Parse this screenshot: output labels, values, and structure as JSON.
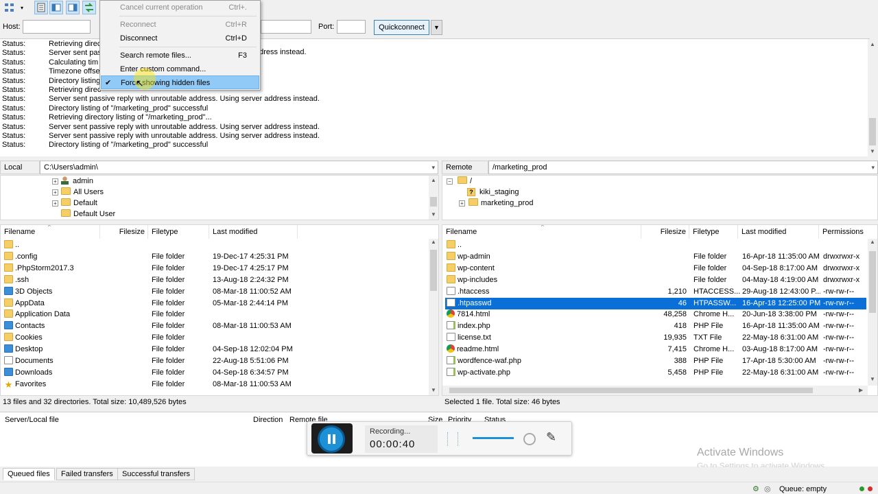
{
  "menu": {
    "items": [
      {
        "label": "Cancel current operation",
        "shortcut": "Ctrl+.",
        "disabled": true
      },
      {
        "label": "Reconnect",
        "shortcut": "Ctrl+R",
        "disabled": true
      },
      {
        "label": "Disconnect",
        "shortcut": "Ctrl+D",
        "disabled": false
      },
      {
        "label": "Search remote files...",
        "shortcut": "F3",
        "disabled": false
      },
      {
        "label": "Enter custom command...",
        "shortcut": "",
        "disabled": false
      },
      {
        "label": "Force showing hidden files",
        "shortcut": "",
        "checked": true,
        "highlighted": true
      }
    ]
  },
  "quickconnect": {
    "host_label": "Host:",
    "host_value": "",
    "port_label": "Port:",
    "port_value": "",
    "button_label": "Quickconnect"
  },
  "log": [
    {
      "key": "Status:",
      "msg": "Retrieving direc"
    },
    {
      "key": "Status:",
      "msg": "Server sent pass"
    },
    {
      "key": "Status:",
      "msg": "Calculating tim"
    },
    {
      "key": "Status:",
      "msg": "Timezone offse"
    },
    {
      "key": "Status:",
      "msg": "Directory listing"
    },
    {
      "key": "Status:",
      "msg": "Retrieving direc"
    },
    {
      "key": "Status:",
      "msg": "Server sent passive reply with unroutable address. Using server address instead."
    },
    {
      "key": "Status:",
      "msg": "Directory listing of \"/marketing_prod\" successful"
    },
    {
      "key": "Status:",
      "msg": "Retrieving directory listing of \"/marketing_prod\"..."
    },
    {
      "key": "Status:",
      "msg": "Server sent passive reply with unroutable address. Using server address instead."
    },
    {
      "key": "Status:",
      "msg": "Server sent passive reply with unroutable address. Using server address instead."
    },
    {
      "key": "Status:",
      "msg": "Directory listing of \"/marketing_prod\" successful"
    }
  ],
  "log_tail_fragment": "ddress instead.",
  "local": {
    "site_label": "Local site:",
    "path": "C:\\Users\\admin\\",
    "tree": [
      "admin",
      "All Users",
      "Default",
      "Default User"
    ],
    "headers": [
      "Filename",
      "Filesize",
      "Filetype",
      "Last modified"
    ],
    "files": [
      {
        "name": "..",
        "size": "",
        "type": "",
        "modified": "",
        "icon": "folder"
      },
      {
        "name": ".config",
        "size": "",
        "type": "File folder",
        "modified": "19-Dec-17 4:25:31 PM",
        "icon": "folder"
      },
      {
        "name": ".PhpStorm2017.3",
        "size": "",
        "type": "File folder",
        "modified": "19-Dec-17 4:25:17 PM",
        "icon": "folder"
      },
      {
        "name": ".ssh",
        "size": "",
        "type": "File folder",
        "modified": "13-Aug-18 2:24:32 PM",
        "icon": "folder"
      },
      {
        "name": "3D Objects",
        "size": "",
        "type": "File folder",
        "modified": "08-Mar-18 11:00:52 AM",
        "icon": "blue"
      },
      {
        "name": "AppData",
        "size": "",
        "type": "File folder",
        "modified": "05-Mar-18 2:44:14 PM",
        "icon": "folder"
      },
      {
        "name": "Application Data",
        "size": "",
        "type": "File folder",
        "modified": "",
        "icon": "folder"
      },
      {
        "name": "Contacts",
        "size": "",
        "type": "File folder",
        "modified": "08-Mar-18 11:00:53 AM",
        "icon": "blue"
      },
      {
        "name": "Cookies",
        "size": "",
        "type": "File folder",
        "modified": "",
        "icon": "folder"
      },
      {
        "name": "Desktop",
        "size": "",
        "type": "File folder",
        "modified": "04-Sep-18 12:02:04 PM",
        "icon": "blue"
      },
      {
        "name": "Documents",
        "size": "",
        "type": "File folder",
        "modified": "22-Aug-18 5:51:06 PM",
        "icon": "file"
      },
      {
        "name": "Downloads",
        "size": "",
        "type": "File folder",
        "modified": "04-Sep-18 6:34:57 PM",
        "icon": "blue"
      },
      {
        "name": "Favorites",
        "size": "",
        "type": "File folder",
        "modified": "08-Mar-18 11:00:53 AM",
        "icon": "star"
      }
    ],
    "status": "13 files and 32 directories. Total size: 10,489,526 bytes"
  },
  "remote": {
    "site_label": "Remote site:",
    "path": "/marketing_prod",
    "tree": [
      "/",
      "kiki_staging",
      "marketing_prod"
    ],
    "headers": [
      "Filename",
      "Filesize",
      "Filetype",
      "Last modified",
      "Permissions"
    ],
    "files": [
      {
        "name": "..",
        "size": "",
        "type": "",
        "modified": "",
        "perms": "",
        "icon": "folder"
      },
      {
        "name": "wp-admin",
        "size": "",
        "type": "File folder",
        "modified": "16-Apr-18 11:35:00 AM",
        "perms": "drwxrwxr-x",
        "icon": "folder"
      },
      {
        "name": "wp-content",
        "size": "",
        "type": "File folder",
        "modified": "04-Sep-18 8:17:00 AM",
        "perms": "drwxrwxr-x",
        "icon": "folder"
      },
      {
        "name": "wp-includes",
        "size": "",
        "type": "File folder",
        "modified": "04-May-18 4:19:00 AM",
        "perms": "drwxrwxr-x",
        "icon": "folder"
      },
      {
        "name": ".htaccess",
        "size": "1,210",
        "type": "HTACCESS...",
        "modified": "29-Aug-18 12:43:00 P...",
        "perms": "-rw-rw-r--",
        "icon": "file"
      },
      {
        "name": ".htpasswd",
        "size": "46",
        "type": "HTPASSW...",
        "modified": "16-Apr-18 12:25:00 PM",
        "perms": "-rw-rw-r--",
        "icon": "file",
        "selected": true
      },
      {
        "name": "7814.html",
        "size": "48,258",
        "type": "Chrome H...",
        "modified": "20-Jun-18 3:38:00 PM",
        "perms": "-rw-rw-r--",
        "icon": "chrome"
      },
      {
        "name": "index.php",
        "size": "418",
        "type": "PHP File",
        "modified": "16-Apr-18 11:35:00 AM",
        "perms": "-rw-rw-r--",
        "icon": "php"
      },
      {
        "name": "license.txt",
        "size": "19,935",
        "type": "TXT File",
        "modified": "22-May-18 6:31:00 AM",
        "perms": "-rw-rw-r--",
        "icon": "file"
      },
      {
        "name": "readme.html",
        "size": "7,415",
        "type": "Chrome H...",
        "modified": "03-Aug-18 8:17:00 AM",
        "perms": "-rw-rw-r--",
        "icon": "chrome"
      },
      {
        "name": "wordfence-waf.php",
        "size": "388",
        "type": "PHP File",
        "modified": "17-Apr-18 5:30:00 AM",
        "perms": "-rw-rw-r--",
        "icon": "php"
      },
      {
        "name": "wp-activate.php",
        "size": "5,458",
        "type": "PHP File",
        "modified": "22-May-18 6:31:00 AM",
        "perms": "-rw-rw-r--",
        "icon": "php"
      }
    ],
    "status": "Selected 1 file. Total size: 46 bytes"
  },
  "queue": {
    "headers": [
      "Server/Local file",
      "Direction",
      "Remote file",
      "Size",
      "Priority",
      "Status"
    ],
    "tabs": [
      "Queued files",
      "Failed transfers",
      "Successful transfers"
    ],
    "status": "Queue: empty"
  },
  "recorder": {
    "label": "Recording...",
    "time": "00:00:40"
  },
  "watermark": {
    "title": "Activate Windows",
    "subtitle": "Go to Settings to activate Windows."
  }
}
